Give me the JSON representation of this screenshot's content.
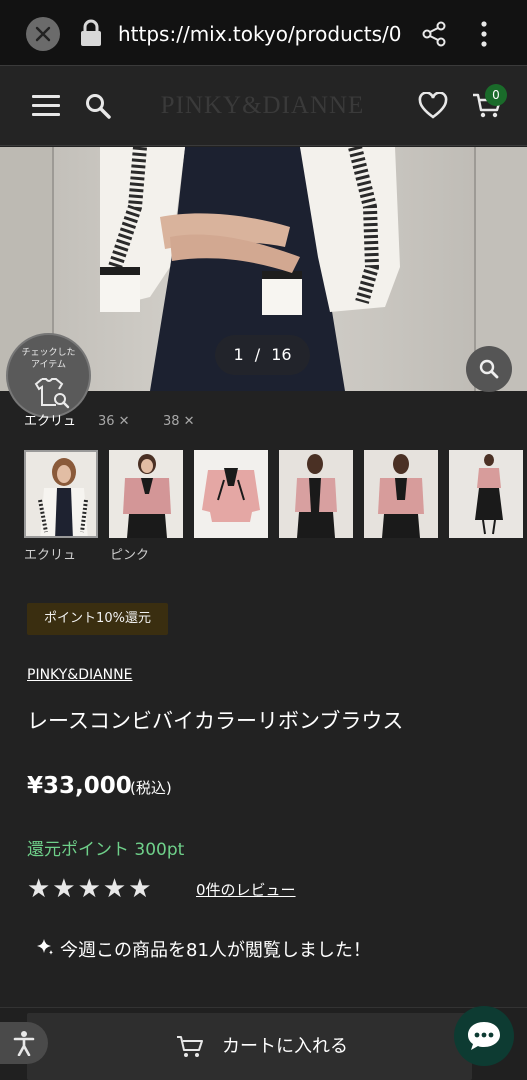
{
  "browser": {
    "url": "https://mix.tokyo/products/0",
    "close_icon": "close-icon",
    "lock_icon": "lock-icon",
    "share_icon": "share-icon",
    "menu_icon": "more-vert-icon"
  },
  "header": {
    "brand_logo": "PINKY&DIANNE",
    "cart_count": "0",
    "menu_icon": "hamburger-icon",
    "search_icon": "search-icon",
    "favorite_icon": "heart-icon",
    "cart_icon": "cart-icon"
  },
  "gallery": {
    "counter_current": "1",
    "counter_sep": "/",
    "counter_total": "16",
    "checked_items_label": "チェックした\nアイテム",
    "zoom_icon": "zoom-icon"
  },
  "filters": {
    "color": "エクリュ",
    "sizes": [
      "36 ✕",
      "38 ✕"
    ]
  },
  "thumbnails": [
    {
      "caption": "エクリュ",
      "tone": "#ebe8e3"
    },
    {
      "caption": "ピンク",
      "tone": "#d39697"
    },
    {
      "caption": "",
      "tone": "#e4a7a4"
    },
    {
      "caption": "",
      "tone": "#d8a0a0"
    },
    {
      "caption": "",
      "tone": "#d79c9b"
    },
    {
      "caption": "",
      "tone": "#e9e6e2"
    }
  ],
  "product": {
    "point_badge": "ポイント10%還元",
    "brand": "PINKY&DIANNE",
    "title": "レースコンビバイカラーリボンブラウス",
    "price": "¥33,000",
    "tax_note": "(税込)",
    "reward_points": "還元ポイント 300pt",
    "rating_stars": "★★★★★",
    "review_link": "0件のレビュー",
    "views_text": "今週この商品を81人が閲覧しました！"
  },
  "bottom": {
    "add_to_cart": "カートに入れる",
    "accessibility_icon": "accessibility-icon",
    "chat_icon": "chat-icon"
  },
  "colors": {
    "background": "#222222",
    "reward_green": "#6fd08a",
    "badge_bg": "#3a2e10",
    "cart_badge": "#1a6b2a",
    "chat_bg": "#0d3b32"
  }
}
